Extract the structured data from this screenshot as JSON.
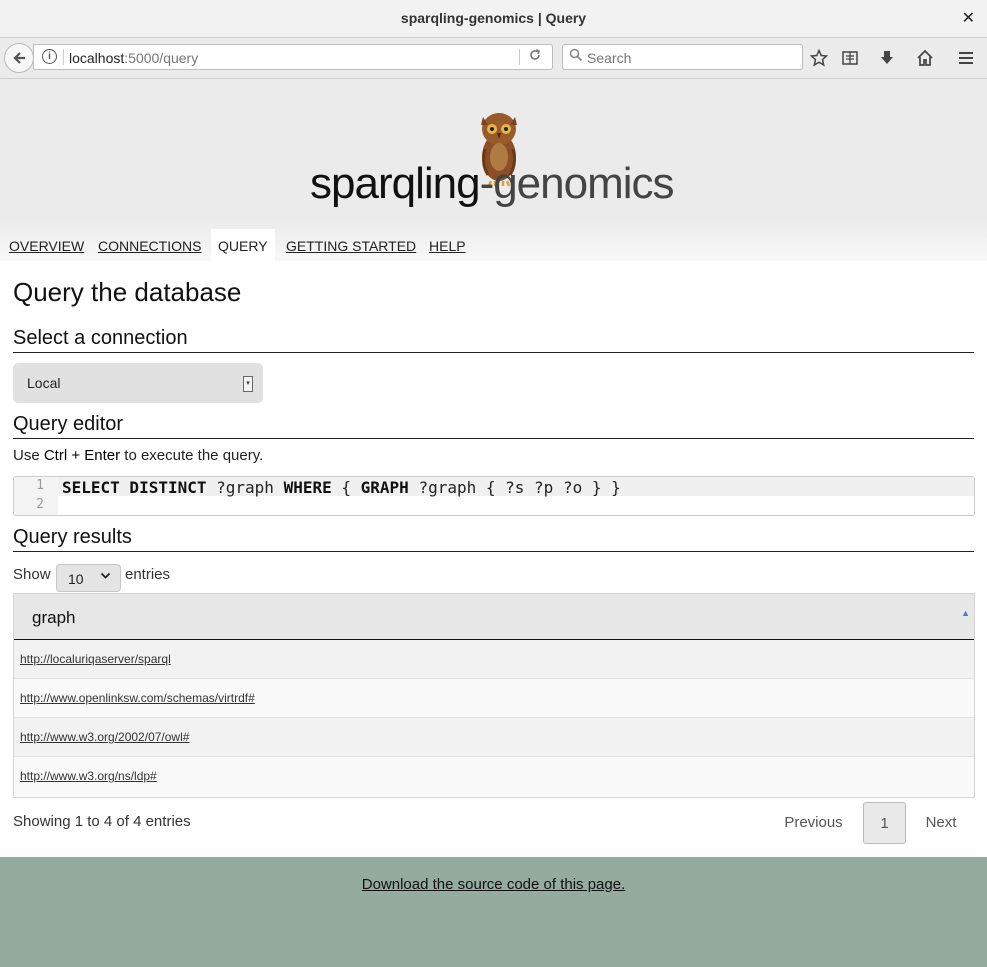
{
  "window": {
    "title": "sparqling-genomics | Query",
    "close_glyph": "✕"
  },
  "browser": {
    "url_host": "localhost",
    "url_rest": ":5000/query",
    "search_placeholder": "Search"
  },
  "logo": {
    "part1": "sparqling",
    "part2": "-genomics"
  },
  "nav": {
    "tabs": [
      {
        "label": "OVERVIEW"
      },
      {
        "label": "CONNECTIONS"
      },
      {
        "label": "QUERY"
      },
      {
        "label": "GETTING STARTED"
      },
      {
        "label": "HELP"
      }
    ],
    "active": "QUERY"
  },
  "page": {
    "title": "Query the database",
    "connection_heading": "Select a connection",
    "connection_value": "Local",
    "editor_heading": "Query editor",
    "hint_prefix": "Use ",
    "hint_keys": "Ctrl + Enter",
    "hint_suffix": " to execute the query.",
    "editor": {
      "line_numbers": [
        "1",
        "2"
      ],
      "tokens": [
        {
          "t": "SELECT DISTINCT",
          "kw": true
        },
        {
          "t": " ?graph ",
          "kw": false
        },
        {
          "t": "WHERE",
          "kw": true
        },
        {
          "t": " { ",
          "kw": false
        },
        {
          "t": "GRAPH",
          "kw": true
        },
        {
          "t": " ?graph { ?s ?p ?o } }",
          "kw": false
        }
      ]
    },
    "results_heading": "Query results"
  },
  "table": {
    "show_label": "Show",
    "page_size": "10",
    "entries_label": "entries",
    "column": "graph",
    "rows": [
      "http://localuriqaserver/sparql",
      "http://www.openlinksw.com/schemas/virtrdf#",
      "http://www.w3.org/2002/07/owl#",
      "http://www.w3.org/ns/ldp#"
    ],
    "info": "Showing 1 to 4 of 4 entries",
    "pager": {
      "previous": "Previous",
      "current": "1",
      "next": "Next"
    }
  },
  "footer": {
    "link": "Download the source code of this page."
  },
  "colors": {
    "footer_bg": "#94ab9d",
    "sort_arrow": "#5a6fc9"
  }
}
